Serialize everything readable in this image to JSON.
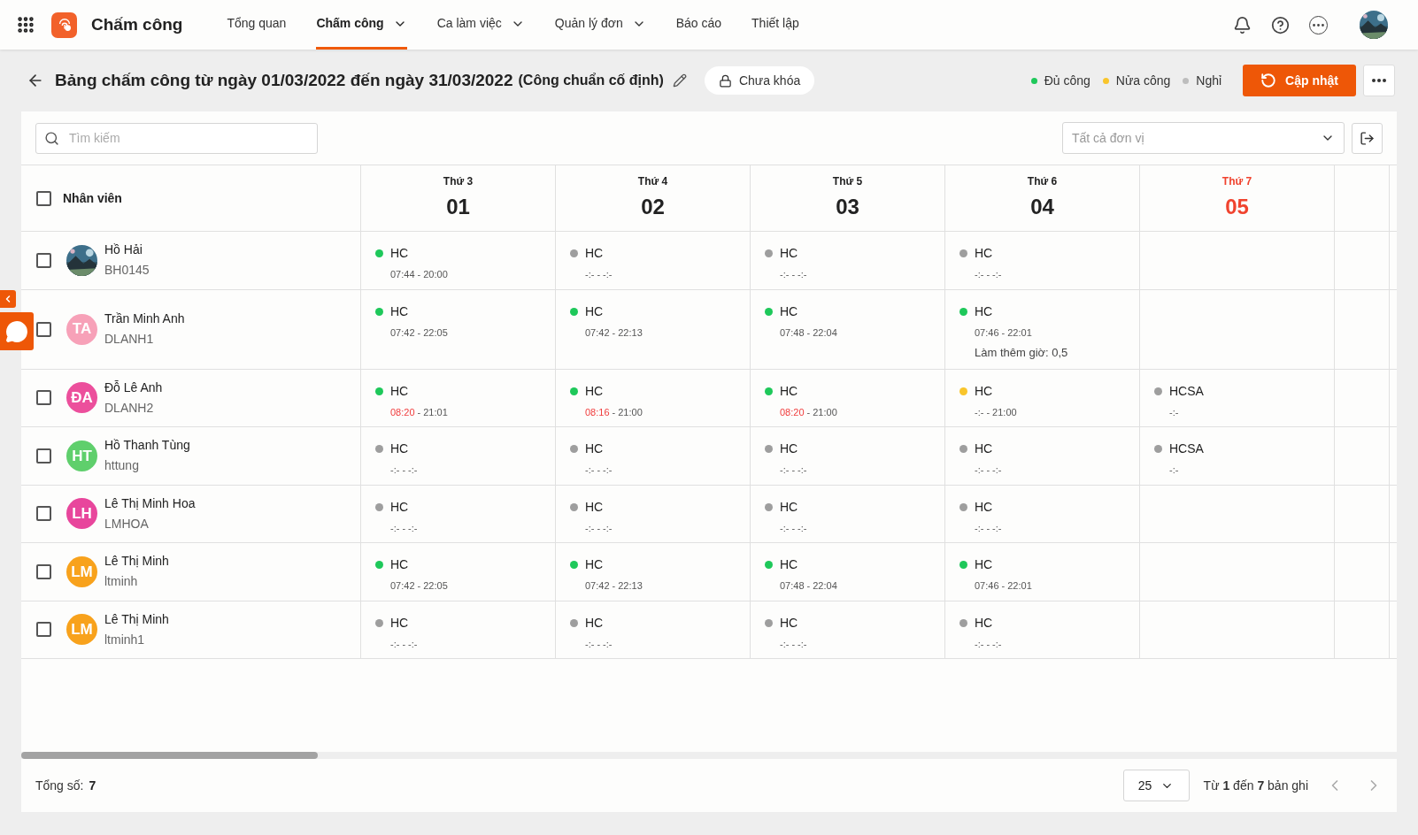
{
  "app": {
    "name": "Chấm công"
  },
  "nav": [
    {
      "label": "Tổng quan",
      "selected": false,
      "dropdown": false
    },
    {
      "label": "Chấm công",
      "selected": true,
      "dropdown": true
    },
    {
      "label": "Ca làm việc",
      "selected": false,
      "dropdown": true
    },
    {
      "label": "Quản lý đơn",
      "selected": false,
      "dropdown": true
    },
    {
      "label": "Báo cáo",
      "selected": false,
      "dropdown": false
    },
    {
      "label": "Thiết lập",
      "selected": false,
      "dropdown": false
    }
  ],
  "page": {
    "title": "Bảng chấm công từ ngày 01/03/2022 đến ngày 31/03/2022",
    "subtitle": "(Công chuẩn cố định)",
    "lock_label": "Chưa khóa",
    "update_button": "Cập nhật"
  },
  "legend": [
    {
      "label": "Đủ công",
      "color": "#1ec85a"
    },
    {
      "label": "Nửa công",
      "color": "#f9c52b"
    },
    {
      "label": "Nghỉ",
      "color": "#bdbdbd"
    }
  ],
  "toolbar": {
    "search_placeholder": "Tìm kiếm",
    "unit_placeholder": "Tất cả đơn vị"
  },
  "table": {
    "employee_header": "Nhân viên",
    "header_checked": false,
    "days": [
      {
        "weekday": "Thứ 3",
        "date": "01",
        "weekend": false
      },
      {
        "weekday": "Thứ 4",
        "date": "02",
        "weekend": false
      },
      {
        "weekday": "Thứ 5",
        "date": "03",
        "weekend": false
      },
      {
        "weekday": "Thứ 6",
        "date": "04",
        "weekend": false
      },
      {
        "weekday": "Thứ 7",
        "date": "05",
        "weekend": true
      }
    ],
    "rows": [
      {
        "name": "Hồ Hải",
        "code": "BH0145",
        "checked": false,
        "avatar": {
          "kind": "picture"
        },
        "cells": [
          {
            "kind": "shift",
            "code": "HC",
            "color": "#1ec85a",
            "time": [
              {
                "text": "07:44",
                "late": false
              },
              {
                "text": "- 20:00",
                "late": false
              }
            ]
          },
          {
            "kind": "shift",
            "code": "HC",
            "color": "#9e9e9e",
            "time": [
              {
                "text": "-:-",
                "late": false
              },
              {
                "text": "- -:-",
                "late": false
              }
            ]
          },
          {
            "kind": "shift",
            "code": "HC",
            "color": "#9e9e9e",
            "time": [
              {
                "text": "-:-",
                "late": false
              },
              {
                "text": "- -:-",
                "late": false
              }
            ]
          },
          {
            "kind": "shift",
            "code": "HC",
            "color": "#9e9e9e",
            "time": [
              {
                "text": "-:-",
                "late": false
              },
              {
                "text": "- -:-",
                "late": false
              }
            ]
          },
          {
            "kind": "empty"
          }
        ]
      },
      {
        "name": "Trần Minh Anh",
        "code": "DLANH1",
        "checked": false,
        "avatar": {
          "kind": "initials",
          "initials": "TA",
          "color": "#f7a1b8"
        },
        "cells": [
          {
            "kind": "shift",
            "code": "HC",
            "color": "#1ec85a",
            "time": [
              {
                "text": "07:42",
                "late": false
              },
              {
                "text": "- 22:05",
                "late": false
              }
            ]
          },
          {
            "kind": "shift",
            "code": "HC",
            "color": "#1ec85a",
            "time": [
              {
                "text": "07:42",
                "late": false
              },
              {
                "text": "- 22:13",
                "late": false
              }
            ]
          },
          {
            "kind": "shift",
            "code": "HC",
            "color": "#1ec85a",
            "time": [
              {
                "text": "07:48",
                "late": false
              },
              {
                "text": "- 22:04",
                "late": false
              }
            ]
          },
          {
            "kind": "shift",
            "code": "HC",
            "color": "#1ec85a",
            "time": [
              {
                "text": "07:46",
                "late": false
              },
              {
                "text": "- 22:01",
                "late": false
              }
            ],
            "note": "Làm thêm giờ: 0,5"
          },
          {
            "kind": "empty"
          }
        ]
      },
      {
        "name": "Đỗ Lê Anh",
        "code": "DLANH2",
        "checked": false,
        "avatar": {
          "kind": "initials",
          "initials": "ĐA",
          "color": "#ec4f9c"
        },
        "cells": [
          {
            "kind": "shift",
            "code": "HC",
            "color": "#1ec85a",
            "time": [
              {
                "text": "08:20",
                "late": true
              },
              {
                "text": "- 21:01",
                "late": false
              }
            ]
          },
          {
            "kind": "shift",
            "code": "HC",
            "color": "#1ec85a",
            "time": [
              {
                "text": "08:16",
                "late": true
              },
              {
                "text": "- 21:00",
                "late": false
              }
            ]
          },
          {
            "kind": "shift",
            "code": "HC",
            "color": "#1ec85a",
            "time": [
              {
                "text": "08:20",
                "late": true
              },
              {
                "text": "- 21:00",
                "late": false
              }
            ]
          },
          {
            "kind": "shift",
            "code": "HC",
            "color": "#f9c52b",
            "time": [
              {
                "text": "-:-",
                "late": false
              },
              {
                "text": "- 21:00",
                "late": false
              }
            ]
          },
          {
            "kind": "shift",
            "code": "HCSA",
            "color": "#9e9e9e",
            "time": [
              {
                "text": "-:-",
                "late": false
              }
            ]
          }
        ]
      },
      {
        "name": "Hồ Thanh Tùng",
        "code": "httung",
        "checked": false,
        "avatar": {
          "kind": "initials",
          "initials": "HT",
          "color": "#5fcf6c"
        },
        "cells": [
          {
            "kind": "shift",
            "code": "HC",
            "color": "#9e9e9e",
            "time": [
              {
                "text": "-:-",
                "late": false
              },
              {
                "text": "- -:-",
                "late": false
              }
            ]
          },
          {
            "kind": "shift",
            "code": "HC",
            "color": "#9e9e9e",
            "time": [
              {
                "text": "-:-",
                "late": false
              },
              {
                "text": "- -:-",
                "late": false
              }
            ]
          },
          {
            "kind": "shift",
            "code": "HC",
            "color": "#9e9e9e",
            "time": [
              {
                "text": "-:-",
                "late": false
              },
              {
                "text": "- -:-",
                "late": false
              }
            ]
          },
          {
            "kind": "shift",
            "code": "HC",
            "color": "#9e9e9e",
            "time": [
              {
                "text": "-:-",
                "late": false
              },
              {
                "text": "- -:-",
                "late": false
              }
            ]
          },
          {
            "kind": "shift",
            "code": "HCSA",
            "color": "#9e9e9e",
            "time": [
              {
                "text": "-:-",
                "late": false
              }
            ]
          }
        ]
      },
      {
        "name": "Lê Thị Minh Hoa",
        "code": "LMHOA",
        "checked": false,
        "avatar": {
          "kind": "initials",
          "initials": "LH",
          "color": "#e8469c"
        },
        "cells": [
          {
            "kind": "shift",
            "code": "HC",
            "color": "#9e9e9e",
            "time": [
              {
                "text": "-:-",
                "late": false
              },
              {
                "text": "- -:-",
                "late": false
              }
            ]
          },
          {
            "kind": "shift",
            "code": "HC",
            "color": "#9e9e9e",
            "time": [
              {
                "text": "-:-",
                "late": false
              },
              {
                "text": "- -:-",
                "late": false
              }
            ]
          },
          {
            "kind": "shift",
            "code": "HC",
            "color": "#9e9e9e",
            "time": [
              {
                "text": "-:-",
                "late": false
              },
              {
                "text": "- -:-",
                "late": false
              }
            ]
          },
          {
            "kind": "shift",
            "code": "HC",
            "color": "#9e9e9e",
            "time": [
              {
                "text": "-:-",
                "late": false
              },
              {
                "text": "- -:-",
                "late": false
              }
            ]
          },
          {
            "kind": "empty"
          }
        ]
      },
      {
        "name": "Lê Thị Minh",
        "code": "ltminh",
        "checked": false,
        "avatar": {
          "kind": "initials",
          "initials": "LM",
          "color": "#f8a21c"
        },
        "cells": [
          {
            "kind": "shift",
            "code": "HC",
            "color": "#1ec85a",
            "time": [
              {
                "text": "07:42",
                "late": false
              },
              {
                "text": "- 22:05",
                "late": false
              }
            ]
          },
          {
            "kind": "shift",
            "code": "HC",
            "color": "#1ec85a",
            "time": [
              {
                "text": "07:42",
                "late": false
              },
              {
                "text": "- 22:13",
                "late": false
              }
            ]
          },
          {
            "kind": "shift",
            "code": "HC",
            "color": "#1ec85a",
            "time": [
              {
                "text": "07:48",
                "late": false
              },
              {
                "text": "- 22:04",
                "late": false
              }
            ]
          },
          {
            "kind": "shift",
            "code": "HC",
            "color": "#1ec85a",
            "time": [
              {
                "text": "07:46",
                "late": false
              },
              {
                "text": "- 22:01",
                "late": false
              }
            ]
          },
          {
            "kind": "empty"
          }
        ]
      },
      {
        "name": "Lê Thị Minh",
        "code": "ltminh1",
        "checked": false,
        "avatar": {
          "kind": "initials",
          "initials": "LM",
          "color": "#f8a21c"
        },
        "cells": [
          {
            "kind": "shift",
            "code": "HC",
            "color": "#9e9e9e",
            "time": [
              {
                "text": "-:-",
                "late": false
              },
              {
                "text": "- -:-",
                "late": false
              }
            ]
          },
          {
            "kind": "shift",
            "code": "HC",
            "color": "#9e9e9e",
            "time": [
              {
                "text": "-:-",
                "late": false
              },
              {
                "text": "- -:-",
                "late": false
              }
            ]
          },
          {
            "kind": "shift",
            "code": "HC",
            "color": "#9e9e9e",
            "time": [
              {
                "text": "-:-",
                "late": false
              },
              {
                "text": "- -:-",
                "late": false
              }
            ]
          },
          {
            "kind": "shift",
            "code": "HC",
            "color": "#9e9e9e",
            "time": [
              {
                "text": "-:-",
                "late": false
              },
              {
                "text": "- -:-",
                "late": false
              }
            ]
          },
          {
            "kind": "empty"
          }
        ]
      }
    ]
  },
  "footer": {
    "total_label": "Tổng số:",
    "total": "7",
    "page_size": "25",
    "range": "Từ **1** đến **7** bản ghi"
  }
}
